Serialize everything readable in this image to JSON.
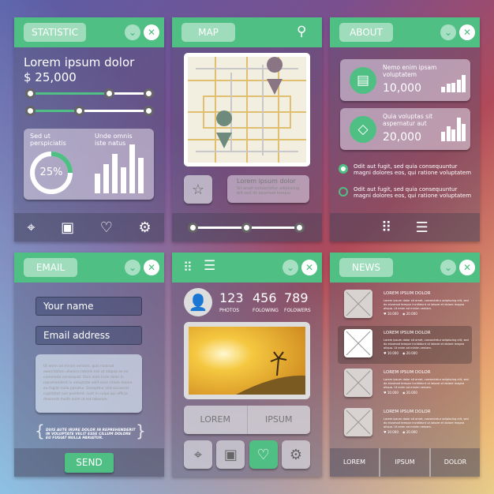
{
  "statistic": {
    "tab": "STATISTIC",
    "title": "Lorem ipsum dolor",
    "amount": "$ 25,000",
    "card_left": "Sed ut perspiciatis",
    "percent": "25%",
    "percent_value": 25,
    "card_right": "Unde omnis iste natus",
    "bars": [
      30,
      45,
      60,
      40,
      75,
      55
    ],
    "sliders": [
      0.55,
      0.4
    ]
  },
  "map": {
    "tab": "MAP",
    "bubble_title": "Lorem ipsum dolor",
    "bubble_text": "Sit amet consectetur adipiscing elit sed do eiusmod tempor",
    "slider": 0.5
  },
  "about": {
    "tab": "ABOUT",
    "stat1_label": "Nemo enim ipsam voluptatem",
    "stat1_value": "10,000",
    "stat2_label": "Quia voluptas sit aspernatur aut",
    "stat2_value": "20,000",
    "option1": "Odit aut fugit, sed quia consequuntur magni dolores eos, qui ratione voluptatem",
    "option2": "Odit aut fugit, sed quia consequuntur magni dolores eos, qui ratione voluptatem"
  },
  "email": {
    "tab": "EMAIL",
    "name_placeholder": "Your name",
    "email_placeholder": "Email address",
    "message": "Ut enim ad minim veniam, quis nostrud exercitation ullamco laboris nisi ut aliquip ex ea commodo consequat. Duis aute irure dolor in reprehenderit in voluptate velit esse cillum dolore eu fugiat nulla pariatur. Excepteur sint occaecat cupidatat non proident, sunt in culpa qui officia deserunt mollit anim id est laborum.",
    "quote": "DUIS AUTE IRURE DOLOR IN REPREHENDERIT IN VOLUPTATE VELIT ESSE CILLUM DOLORE EU FUGIAT NULLA PARIATUR.",
    "send": "SEND"
  },
  "profile": {
    "photos": "123",
    "photos_label": "PHOTOS",
    "following": "456",
    "following_label": "FOLOWING",
    "followers": "789",
    "followers_label": "FOLOWERS",
    "btn1": "LOREM",
    "btn2": "IPSUM"
  },
  "news": {
    "tab": "NEWS",
    "items": [
      {
        "title": "LOREM IPSUM DOLOR",
        "text": "Lorem ipsum dolor sit amet, consectetur adipiscing elit, sed do eiusmod tempor incididunt ut labore et dolore magna aliqua. Ut enim ad minim veniam.",
        "likes": "10.000",
        "views": "20.000"
      },
      {
        "title": "LOREM IPSUM DOLOR",
        "text": "Lorem ipsum dolor sit amet, consectetur adipiscing elit, sed do eiusmod tempor incididunt ut labore et dolore magna aliqua. Ut enim ad minim veniam.",
        "likes": "10.000",
        "views": "20.000"
      },
      {
        "title": "LOREM IPSUM DOLOR",
        "text": "Lorem ipsum dolor sit amet, consectetur adipiscing elit, sed do eiusmod tempor incididunt ut labore et dolore magna aliqua. Ut enim ad minim veniam.",
        "likes": "10.000",
        "views": "20.000"
      },
      {
        "title": "LOREM IPSUM DOLOR",
        "text": "Lorem ipsum dolor sit amet, consectetur adipiscing elit, sed do eiusmod tempor incididunt ut labore et dolore magna aliqua. Ut enim ad minim veniam.",
        "likes": "10.000",
        "views": "20.000"
      }
    ],
    "tabs": [
      "LOREM",
      "IPSUM",
      "DOLOR"
    ]
  }
}
